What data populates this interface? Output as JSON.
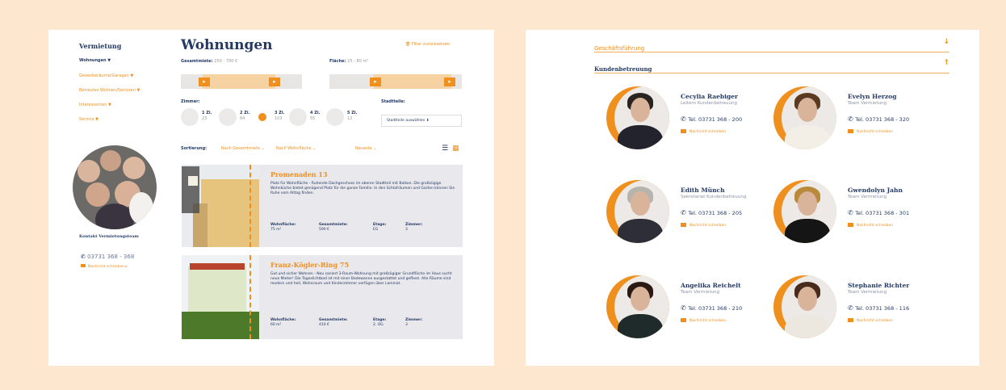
{
  "colors": {
    "accent": "#ef8f1d",
    "navy": "#243a63",
    "background": "#fde7cf"
  },
  "sidebar": {
    "title": "Vermietung",
    "items": [
      {
        "label": "Wohnungen ▼",
        "active": true
      },
      {
        "label": "Gewerberäume/Garagen ▼"
      },
      {
        "label": "Betreutes Wohnen/Senioren ▼"
      },
      {
        "label": "Interessenten ▼"
      },
      {
        "label": "Service ▼"
      }
    ],
    "contact_label": "Kontakt Vermietungsteam",
    "contact_tel": "03731 368 - 368",
    "contact_link": "Nachricht schreiben ▸"
  },
  "main": {
    "title": "Wohnungen",
    "filter_link": "Filter zurücksetzen",
    "rent": {
      "label": "Gesamtmiete:",
      "value": "250 - 700 €"
    },
    "area": {
      "label": "Fläche:",
      "value": "25 - 80 m²"
    },
    "rooms_label": "Zimmer:",
    "rooms": [
      {
        "count": "1 Zi.",
        "num": "23"
      },
      {
        "count": "2 Zi.",
        "num": "64"
      },
      {
        "count": "3 Zi.",
        "num": "103"
      },
      {
        "count": "4 Zi.",
        "num": "55"
      },
      {
        "count": "5 Zi.",
        "num": "12"
      }
    ],
    "district_label": "Stadtteile:",
    "district_button": "Stadtteile auswählen ⬇",
    "sort_label": "Sortierung:",
    "sort_options": [
      "Nach Gesamtmiete ⌄",
      "Nach Wohnfläche ⌄",
      "Neueste ⌄"
    ],
    "listings": [
      {
        "title": "Promenaden 13",
        "text": "Platz für Wohnfläche - Ruhende Dachgeschoss im oberen Stadtteil mit Balkon. Die großzügige Wohnküche bietet genügend Platz für die ganze Familie. In den Schlafräumen und Garten können Sie Ruhe vom Alltag finden.",
        "stats": [
          {
            "label": "Wohnfläche:",
            "value": "75 m²"
          },
          {
            "label": "Gesamtmiete:",
            "value": "590 €"
          },
          {
            "label": "Etage:",
            "value": "EG"
          },
          {
            "label": "Zimmer:",
            "value": "3"
          }
        ]
      },
      {
        "title": "Franz-Kögler-Ring 75",
        "text": "Gut und sicher Wohnen - Neu saniert 3-Raum-Wohnung mit großzügiger Grundfläche im Haus sucht neue Mieter! Die Tageslichtbad ist mit einer Badewanne ausgestattet und gefliest. Alle Räume sind modern und hell, Wohnraum und Kinderzimmer verfügen über Laminat.",
        "stats": [
          {
            "label": "Wohnfläche:",
            "value": "60 m²"
          },
          {
            "label": "Gesamtmiete:",
            "value": "410 €"
          },
          {
            "label": "Etage:",
            "value": "2. OG"
          },
          {
            "label": "Zimmer:",
            "value": "3"
          }
        ]
      }
    ]
  },
  "right": {
    "accordion": [
      {
        "label": "Geschäftsführung",
        "arrow": "↓",
        "open": false
      },
      {
        "label": "Kundenbetreuung",
        "arrow": "↑",
        "open": true
      }
    ],
    "people": [
      {
        "name": "Cecylia Raebiger",
        "role": "Leitern Kundenbetreuung",
        "tel": "Tel. 03731 368 - 200",
        "msg": "Nachricht schreiben",
        "hair": "#2a2420",
        "body": "#23232d"
      },
      {
        "name": "Evelyn Herzog",
        "role": "Team Vermietung",
        "tel": "Tel. 03731 368 - 320",
        "msg": "Nachricht schreiben",
        "hair": "#5b3a22",
        "body": "#f4efe6"
      },
      {
        "name": "Edith Münch",
        "role": "Sekretariat Kundenbetreuung",
        "tel": "Tel. 03731 368 - 205",
        "msg": "Nachricht schreiben",
        "hair": "#b7b3ad",
        "body": "#2e2e38"
      },
      {
        "name": "Gwendolyn Jahn",
        "role": "Team Vermietung",
        "tel": "Tel. 03731 368 - 301",
        "msg": "Nachricht schreiben",
        "hair": "#b98a3a",
        "body": "#151515"
      },
      {
        "name": "Angelika Reichelt",
        "role": "Team Vermietung",
        "tel": "Tel. 03731 368 - 210",
        "msg": "Nachricht schreiben",
        "hair": "#2b1a14",
        "body": "#1f2a2a"
      },
      {
        "name": "Stephanie Richter",
        "role": "Team Vermietung",
        "tel": "Tel. 03731 368 - 116",
        "msg": "Nachricht schreiben",
        "hair": "#4a2a1a",
        "body": "#ece7df"
      }
    ]
  }
}
